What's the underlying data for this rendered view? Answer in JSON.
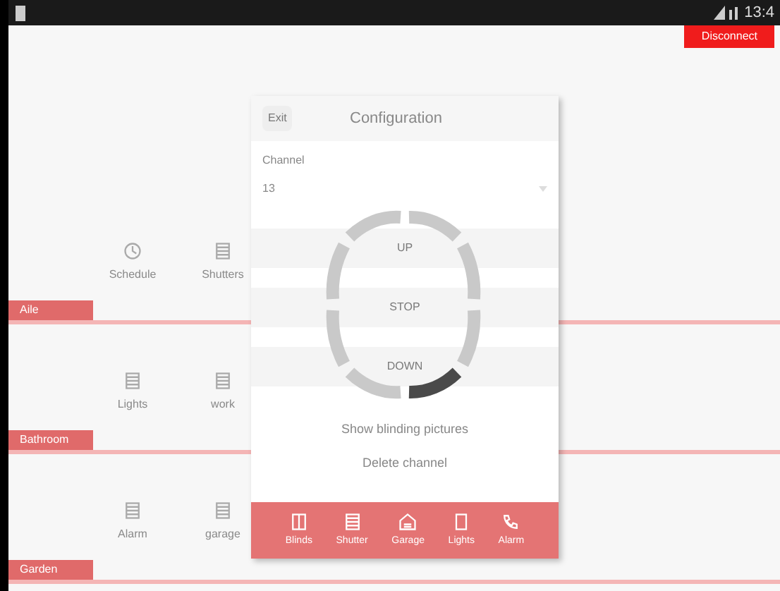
{
  "status_bar": {
    "time": "13:4"
  },
  "top_button": "Disconnect",
  "sections": [
    {
      "label": "Aile",
      "items": [
        {
          "label": "Schedule",
          "kind": "clock"
        },
        {
          "label": "Shutters",
          "kind": "blind"
        }
      ]
    },
    {
      "label": "Bathroom",
      "items": [
        {
          "label": "Lights",
          "kind": "blind"
        },
        {
          "label": "work",
          "kind": "blind"
        }
      ]
    },
    {
      "label": "Garden",
      "items": [
        {
          "label": "Alarm",
          "kind": "blind"
        },
        {
          "label": "garage",
          "kind": "blind"
        }
      ]
    }
  ],
  "dialog": {
    "exit": "Exit",
    "title": "Configuration",
    "channel_label": "Channel",
    "channel_value": "13",
    "commands": [
      "UP",
      "STOP",
      "DOWN"
    ],
    "links": [
      "Show blinding pictures",
      "Delete channel"
    ],
    "footer": [
      {
        "label": "Blinds",
        "kind": "window"
      },
      {
        "label": "Shutter",
        "kind": "blind"
      },
      {
        "label": "Garage",
        "kind": "garage"
      },
      {
        "label": "Lights",
        "kind": "door"
      },
      {
        "label": "Alarm",
        "kind": "phone"
      }
    ]
  }
}
